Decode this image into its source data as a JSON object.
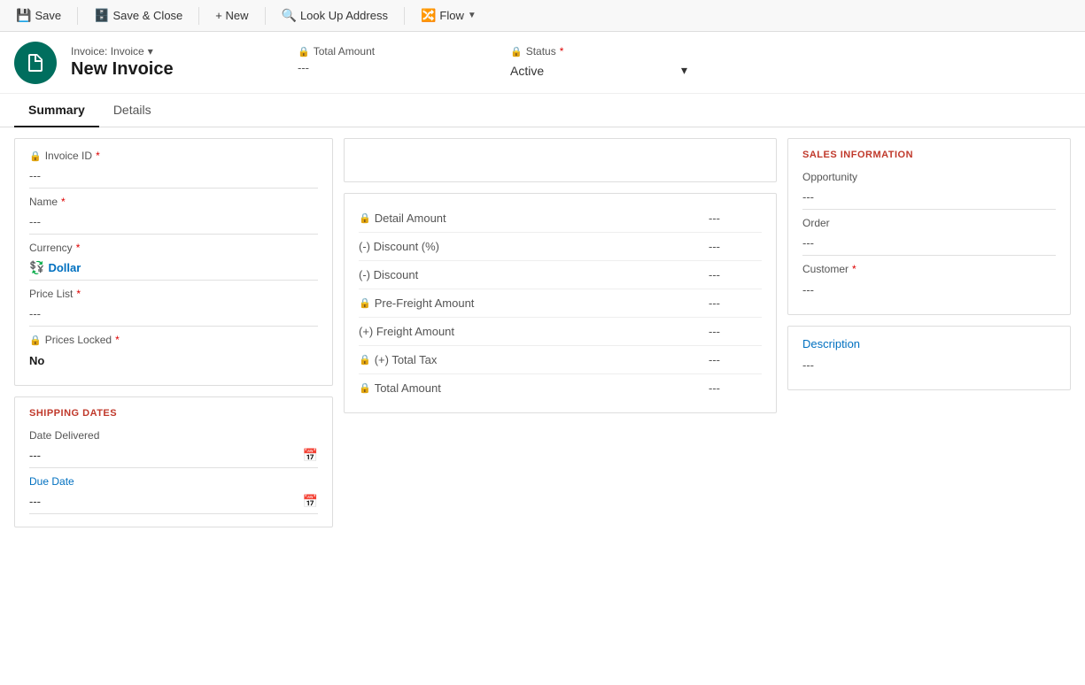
{
  "toolbar": {
    "save_label": "Save",
    "save_close_label": "Save & Close",
    "new_label": "+ New",
    "lookup_label": "Look Up Address",
    "flow_label": "Flow"
  },
  "header": {
    "entity_label": "Invoice: Invoice",
    "record_name": "New Invoice",
    "avatar_icon": "📄",
    "total_amount_label": "Total Amount",
    "total_amount_value": "---",
    "status_label": "Status",
    "status_required": "*",
    "status_value": "Active"
  },
  "tabs": [
    {
      "id": "summary",
      "label": "Summary",
      "active": true
    },
    {
      "id": "details",
      "label": "Details",
      "active": false
    }
  ],
  "summary": {
    "invoice_id_label": "Invoice ID",
    "invoice_id_required": "*",
    "invoice_id_value": "---",
    "name_label": "Name",
    "name_required": "*",
    "name_value": "---",
    "currency_label": "Currency",
    "currency_required": "*",
    "currency_value": "Dollar",
    "price_list_label": "Price List",
    "price_list_required": "*",
    "price_list_value": "---",
    "prices_locked_label": "Prices Locked",
    "prices_locked_required": "*",
    "prices_locked_value": "No"
  },
  "amounts": {
    "detail_amount_label": "Detail Amount",
    "detail_amount_value": "---",
    "discount_pct_label": "(-) Discount (%)",
    "discount_pct_value": "---",
    "discount_label": "(-) Discount",
    "discount_value": "---",
    "pre_freight_label": "Pre-Freight Amount",
    "pre_freight_value": "---",
    "freight_label": "(+) Freight Amount",
    "freight_value": "---",
    "total_tax_label": "(+) Total Tax",
    "total_tax_value": "---",
    "total_amount_label": "Total Amount",
    "total_amount_value": "---"
  },
  "shipping_dates": {
    "section_title": "SHIPPING DATES",
    "date_delivered_label": "Date Delivered",
    "date_delivered_value": "---",
    "due_date_label": "Due Date",
    "due_date_value": "---"
  },
  "sales_info": {
    "section_title": "SALES INFORMATION",
    "opportunity_label": "Opportunity",
    "opportunity_value": "---",
    "order_label": "Order",
    "order_value": "---",
    "customer_label": "Customer",
    "customer_required": "*",
    "customer_value": "---"
  },
  "description": {
    "link_label": "Description",
    "value": "---"
  }
}
